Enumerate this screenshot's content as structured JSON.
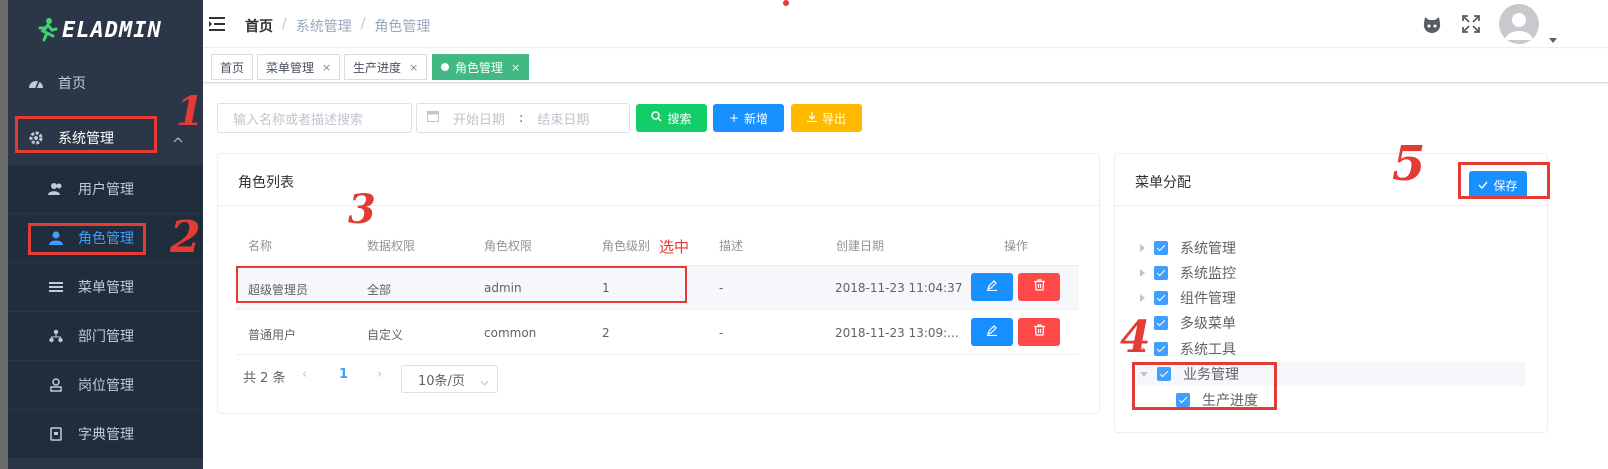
{
  "app": {
    "logo_text": "ELADMIN"
  },
  "sidebar": {
    "items": [
      {
        "label": "首页",
        "icon": "dashboard-icon"
      },
      {
        "label": "系统管理",
        "icon": "gear-icon"
      },
      {
        "label": "用户管理",
        "icon": "users-icon"
      },
      {
        "label": "角色管理",
        "icon": "role-icon"
      },
      {
        "label": "菜单管理",
        "icon": "menu-icon"
      },
      {
        "label": "部门管理",
        "icon": "org-icon"
      },
      {
        "label": "岗位管理",
        "icon": "job-icon"
      },
      {
        "label": "字典管理",
        "icon": "dict-icon"
      }
    ]
  },
  "header": {
    "breadcrumb": [
      "首页",
      "系统管理",
      "角色管理"
    ]
  },
  "tags": [
    {
      "label": "首页"
    },
    {
      "label": "菜单管理",
      "close": "×"
    },
    {
      "label": "生产进度",
      "close": "×"
    },
    {
      "label": "角色管理",
      "close": "×"
    }
  ],
  "filter": {
    "search_placeholder": "输入名称或者描述搜索",
    "start_date_placeholder": "开始日期",
    "date_sep": ":",
    "end_date_placeholder": "结束日期",
    "search_label": "搜索",
    "add_label": "新增",
    "export_label": "导出"
  },
  "role_list": {
    "title": "角色列表",
    "columns": [
      "名称",
      "数据权限",
      "角色权限",
      "角色级别",
      "描述",
      "创建日期",
      "操作"
    ],
    "rows": [
      {
        "name": "超级管理员",
        "data_scope": "全部",
        "permission": "admin",
        "level": "1",
        "desc": "-",
        "created": "2018-11-23 11:04:37"
      },
      {
        "name": "普通用户",
        "data_scope": "自定义",
        "permission": "common",
        "level": "2",
        "desc": "-",
        "created": "2018-11-23 13:09:..."
      }
    ],
    "pagination": {
      "total": "共 2 条",
      "current_page": "1",
      "page_size": "10条/页"
    }
  },
  "menu_assign": {
    "title": "菜单分配",
    "save_label": "保存",
    "tree": [
      {
        "label": "系统管理"
      },
      {
        "label": "系统监控"
      },
      {
        "label": "组件管理"
      },
      {
        "label": "多级菜单"
      },
      {
        "label": "系统工具"
      },
      {
        "label": "业务管理",
        "expanded": true
      },
      {
        "label": "生产进度",
        "child": true
      }
    ]
  },
  "annotations": {
    "n1": "1",
    "n2": "2",
    "n3": "3",
    "n4": "4",
    "n5": "5",
    "selected_note": "选中"
  },
  "colors": {
    "sidebar_bg": "#2b3648",
    "accent": "#409eff",
    "success": "#13ce66",
    "warning": "#ffba00",
    "danger": "#ff4949",
    "tag_active": "#42b983",
    "annotation": "#e53b35"
  }
}
